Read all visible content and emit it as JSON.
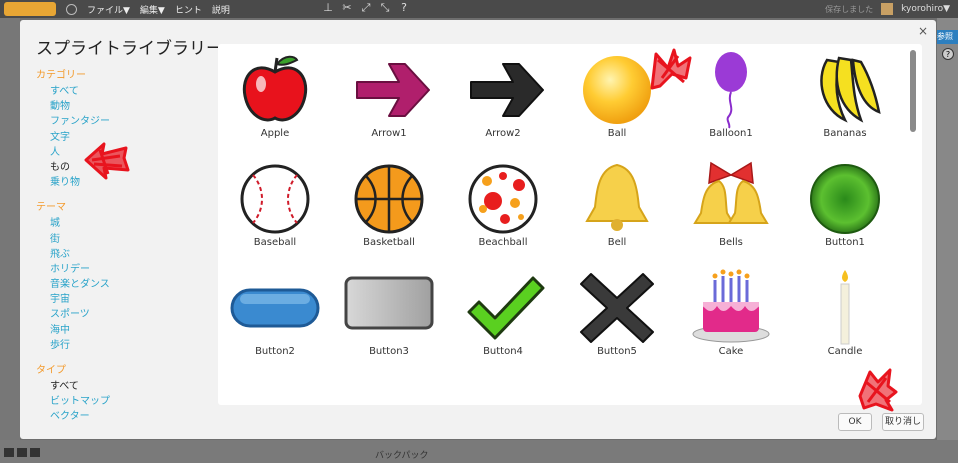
{
  "topbar": {
    "menus": [
      "ファイル▼",
      "編集▼",
      "ヒント",
      "説明"
    ],
    "status": "保存しました",
    "username": "kyorohiro▼"
  },
  "background": {
    "right_button": "参照",
    "bottom_tab": "バックパック"
  },
  "dialog": {
    "title": "スプライトライブラリー",
    "close": "×",
    "ok_label": "OK",
    "cancel_label": "取り消し"
  },
  "sidebar": {
    "category_head": "カテゴリー",
    "categories": [
      "すべて",
      "動物",
      "ファンタジー",
      "文字",
      "人",
      "もの",
      "乗り物"
    ],
    "theme_head": "テーマ",
    "themes": [
      "城",
      "街",
      "飛ぶ",
      "ホリデー",
      "音楽とダンス",
      "宇宙",
      "スポーツ",
      "海中",
      "歩行"
    ],
    "type_head": "タイプ",
    "types": [
      "すべて",
      "ビットマップ",
      "ベクター"
    ]
  },
  "sprites": [
    {
      "name": "Apple",
      "icon": "apple-icon"
    },
    {
      "name": "Arrow1",
      "icon": "arrow1-icon"
    },
    {
      "name": "Arrow2",
      "icon": "arrow2-icon"
    },
    {
      "name": "Ball",
      "icon": "ball-icon"
    },
    {
      "name": "Balloon1",
      "icon": "balloon-icon"
    },
    {
      "name": "Bananas",
      "icon": "bananas-icon"
    },
    {
      "name": "Baseball",
      "icon": "baseball-icon"
    },
    {
      "name": "Basketball",
      "icon": "basketball-icon"
    },
    {
      "name": "Beachball",
      "icon": "beachball-icon"
    },
    {
      "name": "Bell",
      "icon": "bell-icon"
    },
    {
      "name": "Bells",
      "icon": "bells-icon"
    },
    {
      "name": "Button1",
      "icon": "button1-icon"
    },
    {
      "name": "Button2",
      "icon": "button2-icon"
    },
    {
      "name": "Button3",
      "icon": "button3-icon"
    },
    {
      "name": "Button4",
      "icon": "checkmark-icon"
    },
    {
      "name": "Button5",
      "icon": "x-icon"
    },
    {
      "name": "Cake",
      "icon": "cake-icon"
    },
    {
      "name": "Candle",
      "icon": "candle-icon"
    }
  ],
  "colors": {
    "accent_orange": "#f39a2c",
    "link_blue": "#29a3c9",
    "annotation_red": "#e8141e"
  }
}
